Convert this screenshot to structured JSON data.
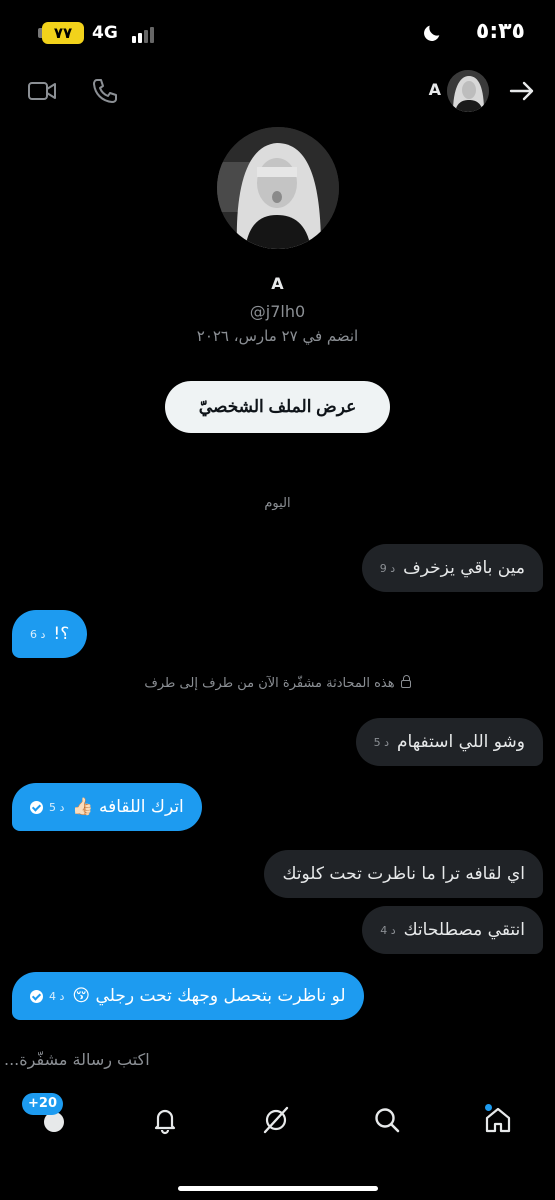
{
  "status_bar": {
    "battery": "٧٧",
    "network": "4G",
    "time": "٥:٣٥"
  },
  "header": {
    "contact_name": "A",
    "icons": [
      "back-arrow-icon",
      "video-call-icon",
      "phone-icon"
    ]
  },
  "profile": {
    "name": "A",
    "handle": "@j7lh0",
    "joined": "انضم في ٢٧ مارس، ٢٠٢٦",
    "view_profile_button": "عرض الملف الشخصيّ"
  },
  "conversation": {
    "day_label": "اليوم",
    "encryption_notice": "هذه المحادثة مشفّرة الآن من طرف إلى طرف",
    "typing_text": "اكتب رسالة مشفّرة...",
    "messages": [
      {
        "direction": "incoming",
        "text": "مين باقي يزخرف",
        "time": "9 د",
        "read": false
      },
      {
        "direction": "outgoing",
        "text": "؟!",
        "time": "6 د",
        "read": false
      },
      {
        "direction": "incoming",
        "text": "وشو اللي استفهام",
        "time": "5 د",
        "read": false
      },
      {
        "direction": "outgoing",
        "text": "اترك اللقافه 👍🏻",
        "time": "5 د",
        "read": true
      },
      {
        "direction": "incoming",
        "text": "اي لقافه ترا ما ناظرت تحت كلوتك",
        "time": "",
        "read": false
      },
      {
        "direction": "incoming",
        "text": "انتقي مصطلحاتك",
        "time": "4 د",
        "read": false
      },
      {
        "direction": "outgoing",
        "text": "لو ناظرت بتحصل وجهك تحت رجلي 😚",
        "time": "4 د",
        "read": true
      }
    ]
  },
  "bottom_nav": {
    "badge": "+20",
    "items": [
      "messages-icon",
      "notifications-bell-icon",
      "grok-icon",
      "search-icon",
      "home-icon"
    ]
  },
  "colors": {
    "background": "#000000",
    "accent": "#1d9bf0",
    "incoming_bubble": "#202327",
    "muted_text": "#8b8f94"
  }
}
